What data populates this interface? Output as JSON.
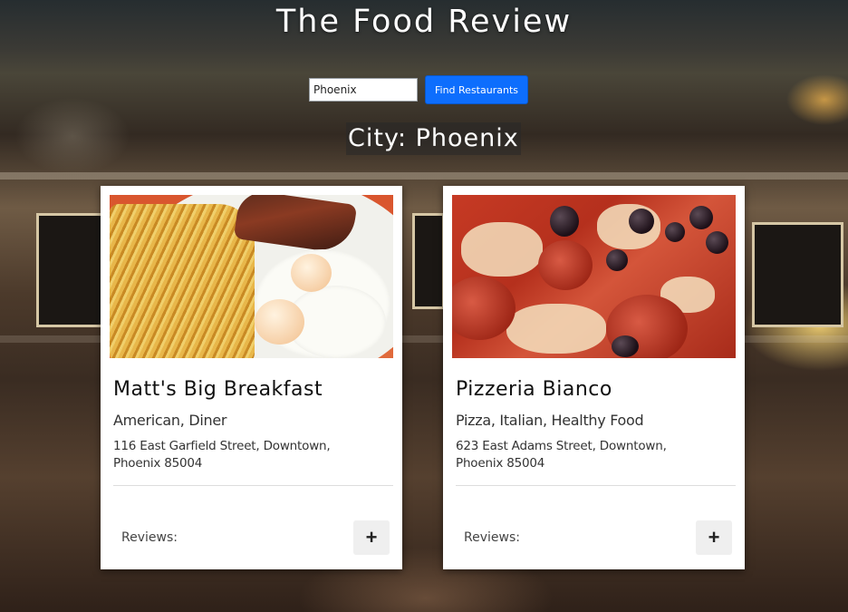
{
  "header": {
    "title": "The Food Review"
  },
  "search": {
    "value": "Phoenix",
    "button_label": "Find Restaurants"
  },
  "city": {
    "heading": "City: Phoenix"
  },
  "restaurants": [
    {
      "name": "Matt's Big Breakfast",
      "categories": "American, Diner",
      "address": "116 East Garfield Street, Downtown, Phoenix 85004",
      "reviews_label": "Reviews:",
      "add_icon": "plus-icon",
      "image_subject": "breakfast-plate"
    },
    {
      "name": "Pizzeria Bianco",
      "categories": "Pizza, Italian, Healthy Food",
      "address": "623 East Adams Street, Downtown, Phoenix 85004",
      "reviews_label": "Reviews:",
      "add_icon": "plus-icon",
      "image_subject": "pizza"
    }
  ],
  "colors": {
    "button_primary": "#0d6efd",
    "card_background": "#ffffff",
    "title_text": "#ffffff"
  }
}
